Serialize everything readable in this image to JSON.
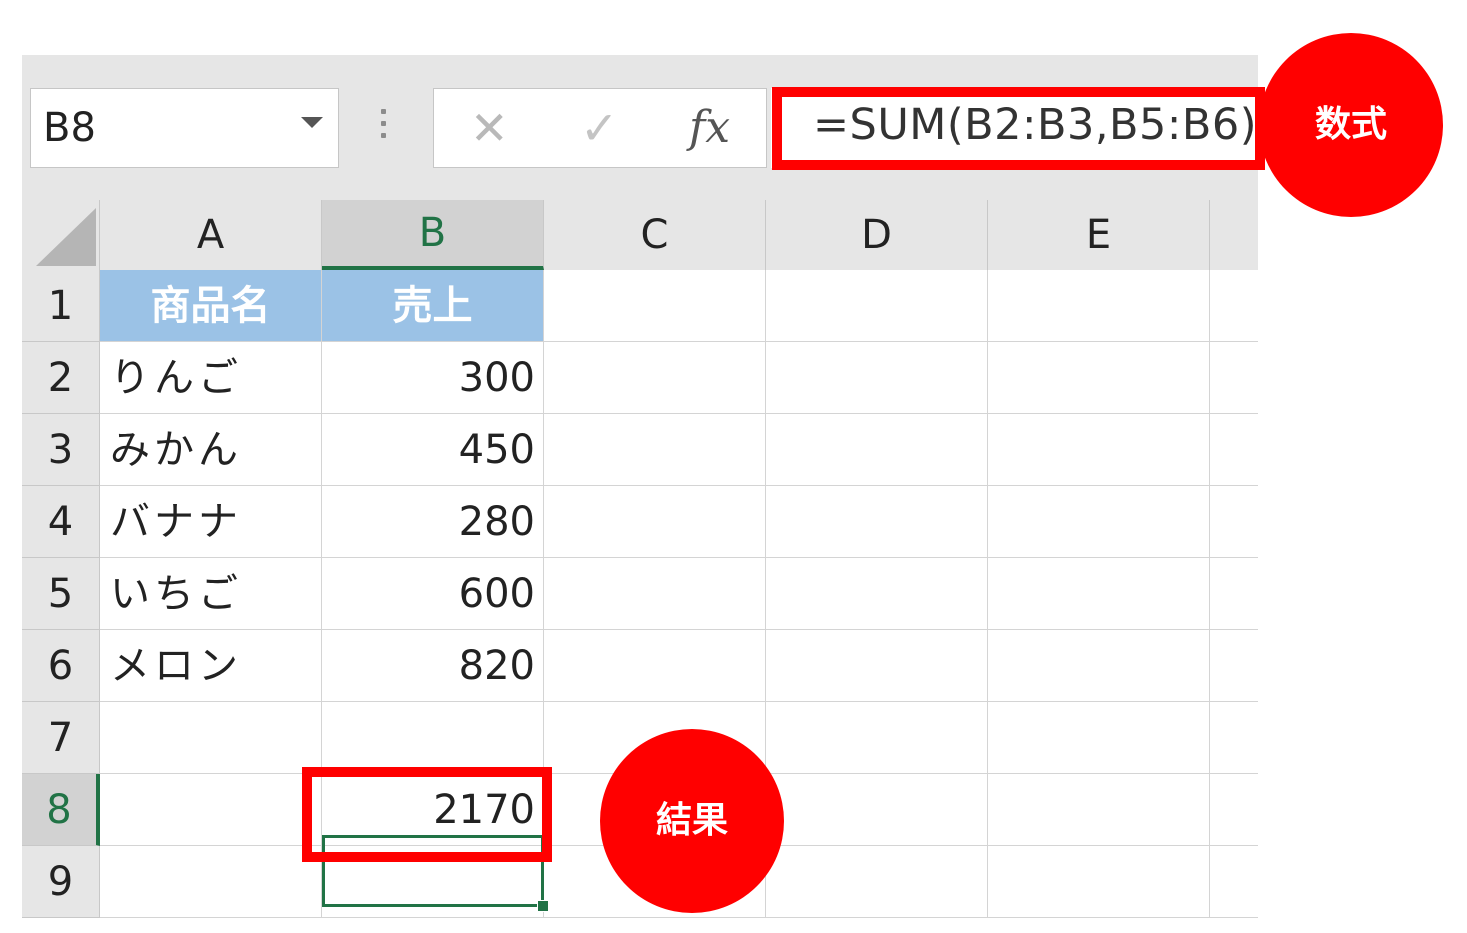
{
  "name_box": {
    "value": "B8"
  },
  "formula_bar": {
    "cancel_icon": "✕",
    "enter_icon": "✓",
    "fx_label": "fx",
    "formula": "=SUM(B2:B3,B5:B6)"
  },
  "sheet": {
    "columns": [
      "A",
      "B",
      "C",
      "D",
      "E"
    ],
    "selected_column": "B",
    "rows": [
      "1",
      "2",
      "3",
      "4",
      "5",
      "6",
      "7",
      "8",
      "9"
    ],
    "selected_row": "8",
    "header_row": {
      "a": "商品名",
      "b": "売上"
    },
    "data": [
      {
        "a": "りんご",
        "b": "300"
      },
      {
        "a": "みかん",
        "b": "450"
      },
      {
        "a": "バナナ",
        "b": "280"
      },
      {
        "a": "いちご",
        "b": "600"
      },
      {
        "a": "メロン",
        "b": "820"
      }
    ],
    "result": "2170"
  },
  "annotations": {
    "formula_label": "数式",
    "result_label": "結果",
    "highlight_color": "#ff0000"
  },
  "colors": {
    "header_fill": "#9bc2e6",
    "selection_accent": "#217346"
  }
}
